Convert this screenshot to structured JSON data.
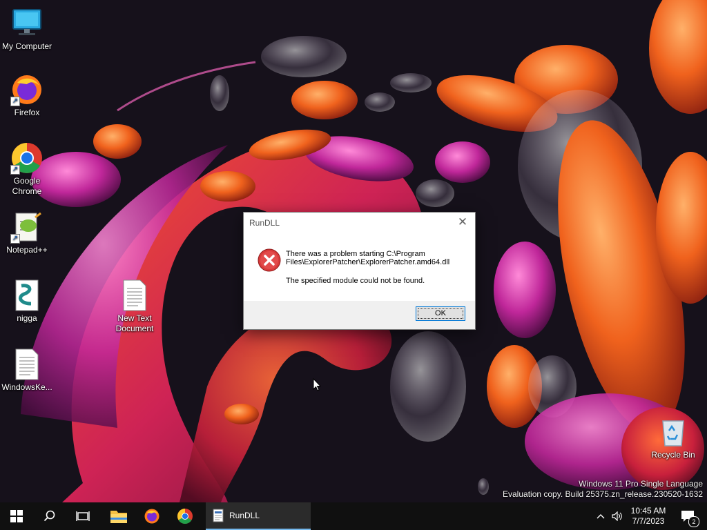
{
  "desktop": {
    "icons": [
      {
        "label": "My Computer",
        "icon": "monitor-icon"
      },
      {
        "label": "Firefox",
        "icon": "firefox-icon"
      },
      {
        "label": "Google Chrome",
        "icon": "chrome-icon"
      },
      {
        "label": "Notepad++",
        "icon": "notepadpp-icon"
      },
      {
        "label": "nigga",
        "icon": "script-file-icon"
      },
      {
        "label": "WindowsKe...",
        "icon": "text-file-icon"
      },
      {
        "label": "New Text Document",
        "icon": "text-file-icon"
      },
      {
        "label": "Recycle Bin",
        "icon": "recycle-bin-icon"
      }
    ],
    "watermark": {
      "line1": "Windows 11 Pro Single Language",
      "line2": "Evaluation copy. Build 25375.zn_release.230520-1632"
    }
  },
  "dialog": {
    "title": "RunDLL",
    "message": "There was a problem starting C:\\Program Files\\ExplorerPatcher\\ExplorerPatcher.amd64.dll",
    "detail": "The specified module could not be found.",
    "ok_label": "OK",
    "close_symbol": "✕"
  },
  "taskbar": {
    "running_app_label": "RunDLL",
    "clock_time": "10:45 AM",
    "clock_date": "7/7/2023",
    "notification_count": "2",
    "accent_color": "#0078d7"
  }
}
